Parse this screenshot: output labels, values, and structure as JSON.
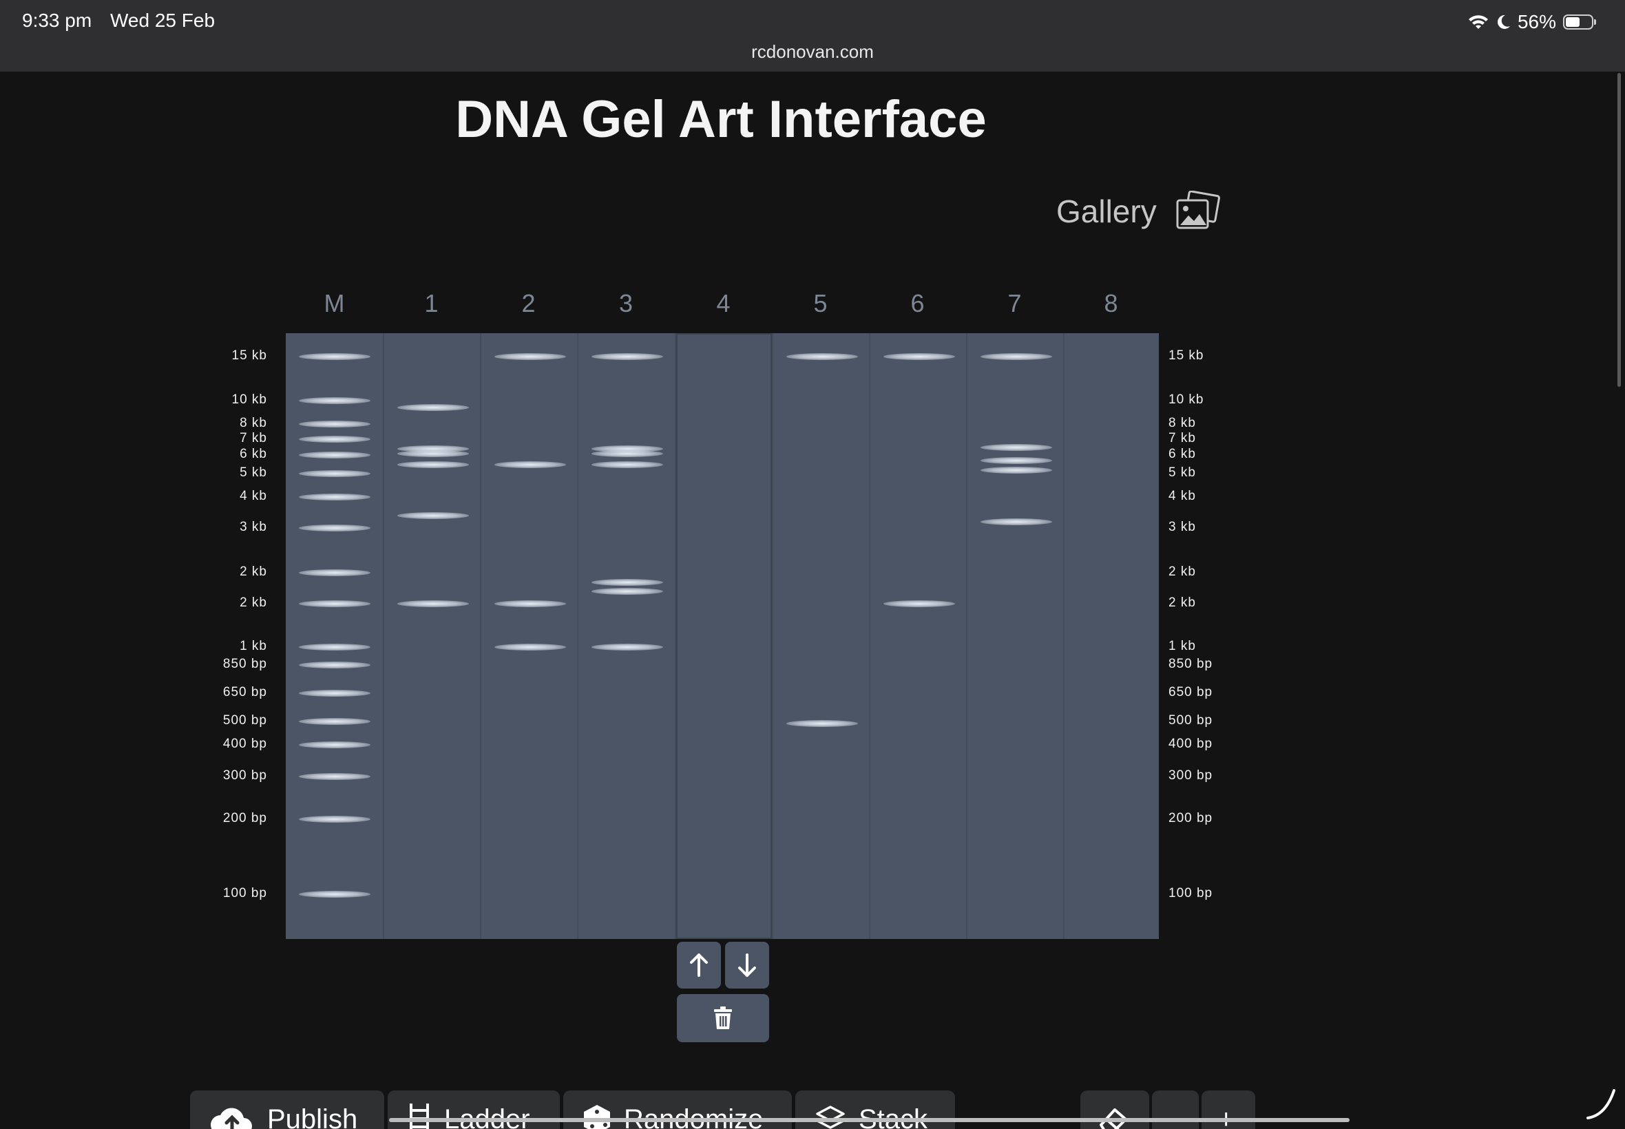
{
  "status_bar": {
    "time": "9:33 pm",
    "date": "Wed 25 Feb",
    "battery_text": "56%",
    "battery_level": 0.56,
    "icons": [
      "wifi-icon",
      "moon-icon",
      "battery-icon"
    ]
  },
  "browser": {
    "url": "rcdonovan.com"
  },
  "page": {
    "title": "DNA Gel Art Interface"
  },
  "gallery": {
    "label": "Gallery",
    "icon": "gallery-photos-icon"
  },
  "gel": {
    "lanes": [
      {
        "label": "M"
      },
      {
        "label": "1"
      },
      {
        "label": "2"
      },
      {
        "label": "3"
      },
      {
        "label": "4"
      },
      {
        "label": "5"
      },
      {
        "label": "6"
      },
      {
        "label": "7"
      },
      {
        "label": "8"
      }
    ],
    "selected_lane": "4",
    "size_labels": [
      "15 kb",
      "10 kb",
      "8 kb",
      "7 kb",
      "6 kb",
      "5 kb",
      "4 kb",
      "3 kb",
      "2 kb",
      "2 kb",
      "1 kb",
      "850 bp",
      "650 bp",
      "500 bp",
      "400 bp",
      "300 bp",
      "200 bp",
      "100 bp"
    ],
    "ladder_band_indices": [
      0,
      1,
      2,
      3,
      4,
      5,
      6,
      7,
      8,
      9,
      10,
      11,
      12,
      13,
      14,
      15,
      16,
      17
    ],
    "lane_bands": {
      "1": [
        1.3,
        3.6,
        3.9,
        4.5,
        6.6,
        9
      ],
      "2": [
        0,
        4.5,
        9,
        10
      ],
      "3": [
        0,
        3.6,
        3.9,
        4.5,
        8.6,
        8.3,
        10
      ],
      "4": [],
      "5": [
        0,
        13.1
      ],
      "6": [
        0,
        9
      ],
      "7": [
        0,
        3.5,
        4.3,
        4.8,
        6.8
      ],
      "8": []
    }
  },
  "lane_controls": {
    "move_up_icon": "arrow-up-icon",
    "move_down_icon": "arrow-down-icon",
    "delete_icon": "trash-icon"
  },
  "toolbar": {
    "publish": "Publish",
    "ladder": "Ladder",
    "randomize": "Randomize",
    "stack": "Stack",
    "zoom_out": "-",
    "zoom_in": "+"
  }
}
